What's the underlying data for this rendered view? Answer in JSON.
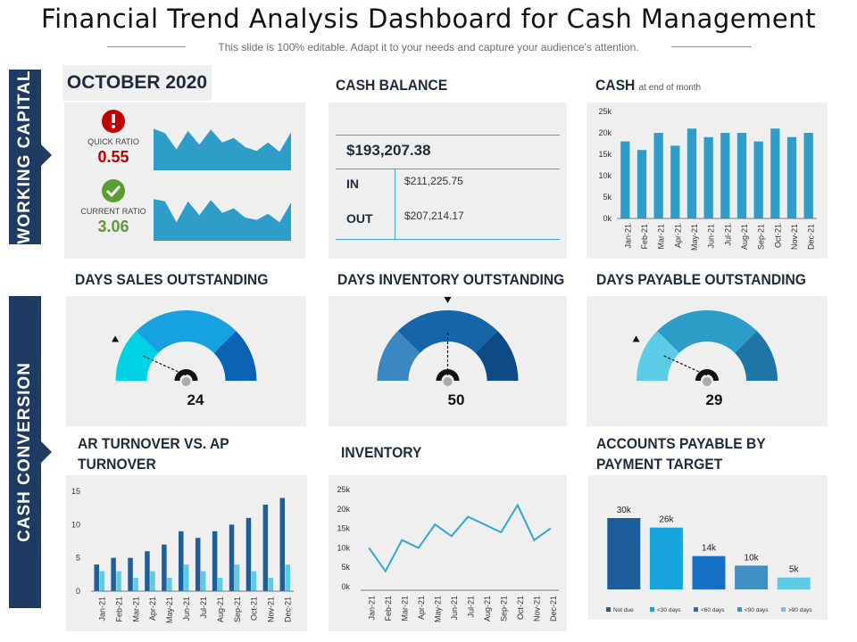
{
  "header": {
    "title": "Financial Trend Analysis Dashboard for Cash Management",
    "subtitle": "This slide is 100% editable. Adapt it to your needs and capture your audience's attention."
  },
  "sidebar": {
    "working_capital": "WORKING CAPITAL",
    "cash_conversion": "CASH CONVERSION"
  },
  "period": "OCTOBER 2020",
  "ratios": {
    "quick": {
      "label": "QUICK RATIO",
      "value": "0.55",
      "icon": "alert-icon",
      "color": "#c00000"
    },
    "current": {
      "label": "CURRENT RATIO",
      "value": "3.06",
      "icon": "check-icon",
      "color": "#5a9e32"
    }
  },
  "cash_balance": {
    "title": "CASH BALANCE",
    "total": "$193,207.38",
    "in_label": "IN",
    "in_value": "$211,225.75",
    "out_label": "OUT",
    "out_value": "$207,214.17"
  },
  "cash_chart": {
    "title": "CASH",
    "note": "at end of month"
  },
  "gauges": [
    {
      "title": "DAYS SALES OUTSTANDING",
      "value": "24",
      "active_segment": 0,
      "colors": [
        "#1ecde0",
        "#16a2e0",
        "#0b63b6"
      ],
      "active_color": "#00d2e6"
    },
    {
      "title": "DAYS INVENTORY OUTSTANDING",
      "value": "50",
      "active_segment": 1,
      "colors": [
        "#3a87c2",
        "#1565a8",
        "#0c4b86"
      ],
      "active_color": "#1565a8"
    },
    {
      "title": "DAYS PAYABLE OUTSTANDING",
      "value": "29",
      "active_segment": 0,
      "colors": [
        "#5ccbe6",
        "#2a9dc8",
        "#1e75a8"
      ],
      "active_color": "#5ccbe6"
    }
  ],
  "bottom_titles": {
    "ar_ap": "AR TURNOVER VS. AP TURNOVER",
    "inventory": "INVENTORY",
    "ap_target": "ACCOUNTS PAYABLE BY PAYMENT TARGET"
  },
  "chart_data": [
    {
      "id": "working-capital-sparklines",
      "type": "area",
      "series": [
        {
          "values": [
            90,
            80,
            45,
            85,
            55,
            88,
            60,
            70,
            50,
            42,
            60,
            40,
            82
          ]
        },
        {
          "values": [
            90,
            85,
            40,
            85,
            55,
            88,
            60,
            70,
            50,
            45,
            58,
            40,
            82
          ]
        }
      ],
      "color": "#2e9dc9"
    },
    {
      "id": "cash-chart",
      "type": "bar",
      "categories": [
        "Jan-21",
        "Feb-21",
        "Mar-21",
        "Apr-21",
        "May-21",
        "Jun-21",
        "Jul-21",
        "Aug-21",
        "Sep-21",
        "Oct-21",
        "Nov-21",
        "Dec-21"
      ],
      "values": [
        18000,
        16000,
        20000,
        17000,
        21000,
        19000,
        20000,
        20000,
        18000,
        21000,
        19000,
        20000
      ],
      "ylim": [
        0,
        25000
      ],
      "yticks": [
        "0k",
        "5k",
        "10k",
        "15k",
        "20k",
        "25k"
      ],
      "color": "#2e9dc9",
      "grid": false
    },
    {
      "id": "ar-ap-turnover",
      "type": "bar",
      "categories": [
        "Jan-21",
        "Feb-21",
        "Mar-21",
        "Apr-21",
        "May-21",
        "Jun-21",
        "Jul-21",
        "Aug-21",
        "Sep-21",
        "Oct-21",
        "Nov-21",
        "Dec-21"
      ],
      "series": [
        {
          "values": [
            4,
            5,
            5,
            6,
            7,
            9,
            8,
            9,
            10,
            11,
            13,
            14
          ],
          "color": "#1f5f99"
        },
        {
          "values": [
            3,
            3,
            2,
            3,
            2,
            4,
            3,
            2,
            4,
            3,
            2,
            4
          ],
          "color": "#5ccbe6"
        }
      ],
      "ylim": [
        0,
        15
      ],
      "yticks": [
        "0",
        "5",
        "10",
        "15"
      ]
    },
    {
      "id": "inventory-chart",
      "type": "line",
      "categories": [
        "Jan-21",
        "Feb-21",
        "Mar-21",
        "Apr-21",
        "May-21",
        "Jun-21",
        "Jul-21",
        "Aug-21",
        "Sep-21",
        "Oct-21",
        "Nov-21",
        "Dec-21"
      ],
      "values": [
        10000,
        4000,
        12000,
        10000,
        16000,
        13000,
        18000,
        16000,
        14000,
        21000,
        12000,
        15000
      ],
      "ylim": [
        0,
        25000
      ],
      "yticks": [
        "0k",
        "5k",
        "10k",
        "15k",
        "20k",
        "25k"
      ],
      "color": "#2ea7dc"
    },
    {
      "id": "ap-payment-target",
      "type": "bar",
      "categories": [
        "Not due",
        "<30 days",
        "<60 days",
        "<90 days",
        ">90 days"
      ],
      "values": [
        30,
        26,
        14,
        10,
        5
      ],
      "labels": [
        "30k",
        "26k",
        "14k",
        "10k",
        "5k"
      ],
      "colors": [
        "#1b5c9b",
        "#17a3dc",
        "#1670c4",
        "#3d8fc4",
        "#5ccbe6"
      ],
      "ylim": [
        0,
        30
      ]
    }
  ]
}
